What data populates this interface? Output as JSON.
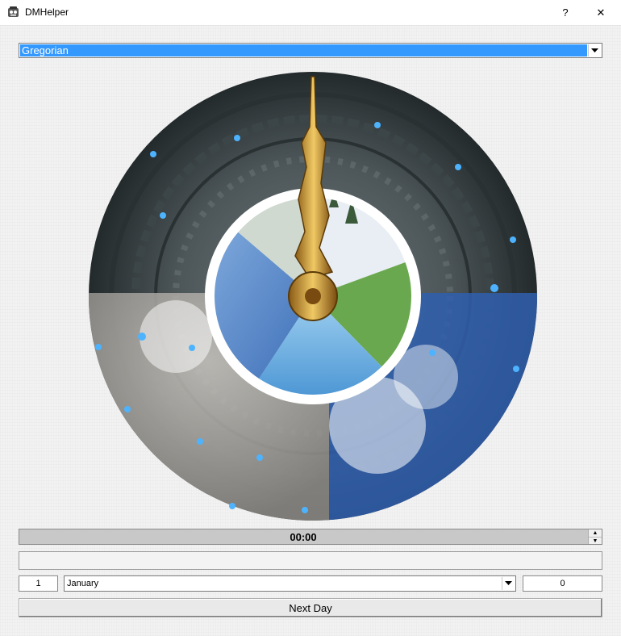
{
  "window": {
    "title": "DMHelper",
    "help_label": "?",
    "close_label": "✕"
  },
  "calendar": {
    "selected": "Gregorian"
  },
  "time": {
    "value": "00:00"
  },
  "date": {
    "day": "1",
    "month": "January",
    "year": "0"
  },
  "actions": {
    "next_day_label": "Next Day"
  },
  "colors": {
    "selection": "#3399ff"
  }
}
